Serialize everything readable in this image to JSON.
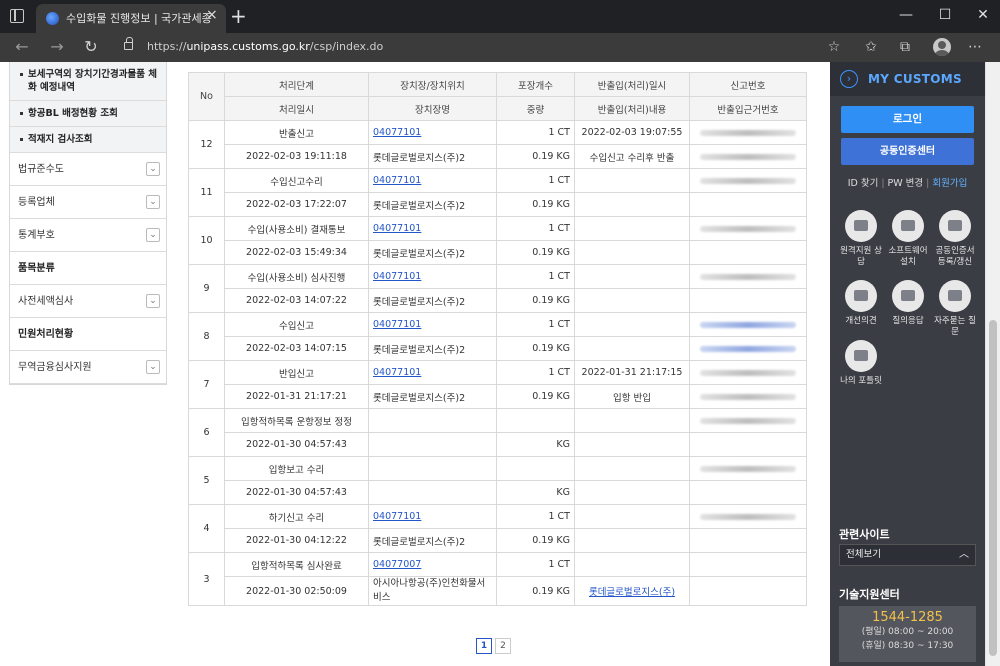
{
  "browser": {
    "tab_title": "수입화물 진행정보 | 국가관세종",
    "tab_close": "×",
    "new_tab": "+",
    "url_prefix": "https://",
    "url_host": "unipass.customs.go.kr",
    "url_path": "/csp/index.do"
  },
  "sidebar": {
    "sub_items": [
      {
        "label": "보세구역외 장치기간경과물품 체화 예정내역"
      },
      {
        "label": "항공BL 배정현황 조회"
      },
      {
        "label": "적재지 검사조회"
      }
    ],
    "items": [
      {
        "label": "법규준수도",
        "expandable": true,
        "bold": false
      },
      {
        "label": "등록업체",
        "expandable": true,
        "bold": false
      },
      {
        "label": "통계부호",
        "expandable": true,
        "bold": false
      },
      {
        "label": "품목분류",
        "expandable": false,
        "bold": true
      },
      {
        "label": "사전세액심사",
        "expandable": true,
        "bold": false
      },
      {
        "label": "민원처리현황",
        "expandable": false,
        "bold": true
      },
      {
        "label": "무역금융심사지원",
        "expandable": true,
        "bold": false
      }
    ]
  },
  "table": {
    "headers_top": [
      "No",
      "처리단계",
      "장치장/장치위치",
      "포장개수",
      "반출입(처리)일시",
      "신고번호"
    ],
    "headers_bottom": [
      "처리일시",
      "장치장명",
      "중량",
      "반출입(처리)내용",
      "반출입근거번호"
    ],
    "rows": [
      {
        "no": "12",
        "stage": "반출신고",
        "datetime": "2022-02-03 19:11:18",
        "code": "04077101",
        "name": "롯데글로벌로지스(주)2",
        "pkg": "1 CT",
        "weight": "0.19 KG",
        "io_time": "2022-02-03 19:07:55",
        "io_content": "수입신고 수리후 반출",
        "blur_top": true,
        "blur_bottom": true,
        "blue_top": false,
        "blue_bottom": false,
        "io_link": false
      },
      {
        "no": "11",
        "stage": "수입신고수리",
        "datetime": "2022-02-03 17:22:07",
        "code": "04077101",
        "name": "롯데글로벌로지스(주)2",
        "pkg": "1 CT",
        "weight": "0.19 KG",
        "io_time": "",
        "io_content": "",
        "blur_top": true,
        "blur_bottom": false,
        "blue_top": false,
        "blue_bottom": false,
        "io_link": false
      },
      {
        "no": "10",
        "stage": "수입(사용소비) 결재통보",
        "datetime": "2022-02-03 15:49:34",
        "code": "04077101",
        "name": "롯데글로벌로지스(주)2",
        "pkg": "1 CT",
        "weight": "0.19 KG",
        "io_time": "",
        "io_content": "",
        "blur_top": true,
        "blur_bottom": false,
        "blue_top": false,
        "blue_bottom": false,
        "io_link": false
      },
      {
        "no": "9",
        "stage": "수입(사용소비) 심사진행",
        "datetime": "2022-02-03 14:07:22",
        "code": "04077101",
        "name": "롯데글로벌로지스(주)2",
        "pkg": "1 CT",
        "weight": "0.19 KG",
        "io_time": "",
        "io_content": "",
        "blur_top": true,
        "blur_bottom": false,
        "blue_top": false,
        "blue_bottom": false,
        "io_link": false
      },
      {
        "no": "8",
        "stage": "수입신고",
        "datetime": "2022-02-03 14:07:15",
        "code": "04077101",
        "name": "롯데글로벌로지스(주)2",
        "pkg": "1 CT",
        "weight": "0.19 KG",
        "io_time": "",
        "io_content": "",
        "blur_top": true,
        "blur_bottom": true,
        "blue_top": true,
        "blue_bottom": true,
        "io_link": false
      },
      {
        "no": "7",
        "stage": "반입신고",
        "datetime": "2022-01-31 21:17:21",
        "code": "04077101",
        "name": "롯데글로벌로지스(주)2",
        "pkg": "1 CT",
        "weight": "0.19 KG",
        "io_time": "2022-01-31 21:17:15",
        "io_content": "입항 반입",
        "blur_top": true,
        "blur_bottom": true,
        "blue_top": false,
        "blue_bottom": false,
        "io_link": false
      },
      {
        "no": "6",
        "stage": "입항적하목록 운항정보 정정",
        "datetime": "2022-01-30 04:57:43",
        "code": "",
        "name": "",
        "pkg": "",
        "weight": "KG",
        "io_time": "",
        "io_content": "",
        "blur_top": true,
        "blur_bottom": false,
        "blue_top": false,
        "blue_bottom": false,
        "io_link": false
      },
      {
        "no": "5",
        "stage": "입항보고 수리",
        "datetime": "2022-01-30 04:57:43",
        "code": "",
        "name": "",
        "pkg": "",
        "weight": "KG",
        "io_time": "",
        "io_content": "",
        "blur_top": true,
        "blur_bottom": false,
        "blue_top": false,
        "blue_bottom": false,
        "io_link": false
      },
      {
        "no": "4",
        "stage": "하기신고 수리",
        "datetime": "2022-01-30 04:12:22",
        "code": "04077101",
        "name": "롯데글로벌로지스(주)2",
        "pkg": "1 CT",
        "weight": "0.19 KG",
        "io_time": "",
        "io_content": "",
        "blur_top": true,
        "blur_bottom": false,
        "blue_top": false,
        "blue_bottom": false,
        "io_link": false
      },
      {
        "no": "3",
        "stage": "입항적하목록 심사완료",
        "datetime": "2022-01-30 02:50:09",
        "code": "04077007",
        "name": "아시아나항공(주)인천화물서비스",
        "pkg": "1 CT",
        "weight": "0.19 KG",
        "io_time": "",
        "io_content": "롯데글로벌로지스(주)",
        "blur_top": false,
        "blur_bottom": false,
        "blue_top": false,
        "blue_bottom": false,
        "io_link": true
      }
    ]
  },
  "pagination": {
    "pages": [
      "1",
      "2"
    ],
    "active": "1"
  },
  "right_panel": {
    "title": "MY CUSTOMS",
    "title_icon": "›",
    "login_button": "로그인",
    "cert_button": "공동인증센터",
    "link_id": "ID 찾기",
    "link_pw": "PW 변경",
    "link_join": "회원가입",
    "link_sep": "|",
    "icons": [
      {
        "label": "원격지원 상담",
        "icon": "remote-support-icon"
      },
      {
        "label": "소프트웨어 설치",
        "icon": "software-install-icon"
      },
      {
        "label": "공동인증서 등록/갱신",
        "icon": "certificate-icon"
      },
      {
        "label": "개선의견",
        "icon": "feedback-icon"
      },
      {
        "label": "질의응답",
        "icon": "qna-icon"
      },
      {
        "label": "자주묻는 질문",
        "icon": "faq-icon"
      },
      {
        "label": "나의 포틀릿",
        "icon": "portlet-icon"
      }
    ],
    "related_title": "관련사이트",
    "related_select": "전체보기",
    "tech_title": "기술지원센터",
    "tech_phone": "1544-1285",
    "tech_weekday": "(평일) 08:00 ~ 20:00",
    "tech_holiday": "(휴일) 08:30 ~ 17:30"
  }
}
